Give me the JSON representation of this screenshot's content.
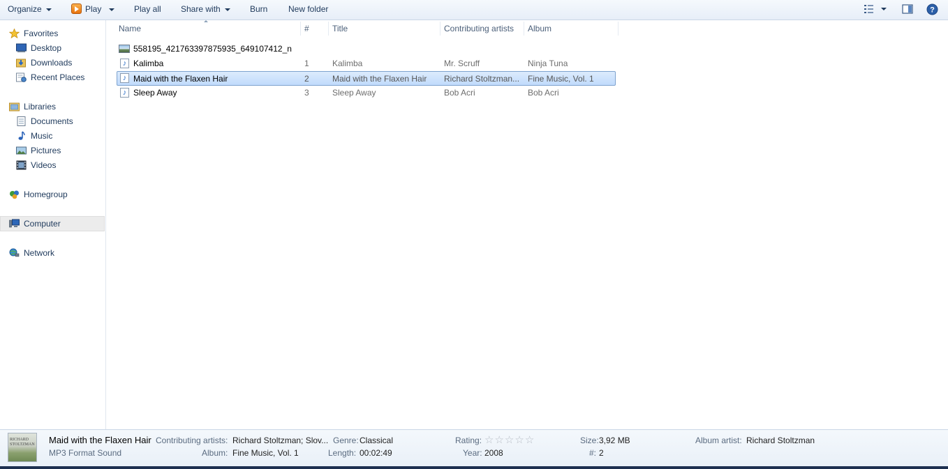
{
  "toolbar": {
    "organize": "Organize",
    "play": "Play",
    "play_all": "Play all",
    "share_with": "Share with",
    "burn": "Burn",
    "new_folder": "New folder"
  },
  "nav": {
    "favorites": "Favorites",
    "desktop": "Desktop",
    "downloads": "Downloads",
    "recent_places": "Recent Places",
    "libraries": "Libraries",
    "documents": "Documents",
    "music": "Music",
    "pictures": "Pictures",
    "videos": "Videos",
    "homegroup": "Homegroup",
    "computer": "Computer",
    "network": "Network"
  },
  "columns": {
    "name": "Name",
    "number": "#",
    "title": "Title",
    "artists": "Contributing artists",
    "album": "Album"
  },
  "files": [
    {
      "name": "558195_421763397875935_649107412_n",
      "number": "",
      "title": "",
      "artists": "",
      "album": "",
      "type": "image"
    },
    {
      "name": "Kalimba",
      "number": "1",
      "title": "Kalimba",
      "artists": "Mr. Scruff",
      "album": "Ninja Tuna",
      "type": "audio"
    },
    {
      "name": "Maid with the Flaxen Hair",
      "number": "2",
      "title": "Maid with the Flaxen Hair",
      "artists": "Richard Stoltzman...",
      "album": "Fine Music, Vol. 1",
      "type": "audio",
      "selected": true
    },
    {
      "name": "Sleep Away",
      "number": "3",
      "title": "Sleep Away",
      "artists": "Bob Acri",
      "album": "Bob Acri",
      "type": "audio"
    }
  ],
  "details": {
    "thumb_text": "RICHARD STOLTZMAN",
    "title": "Maid with the Flaxen Hair",
    "type": "MP3 Format Sound",
    "artists_label": "Contributing artists:",
    "artists_value": "Richard Stoltzman; Slov...",
    "album_label": "Album:",
    "album_value": "Fine Music, Vol. 1",
    "genre_label": "Genre:",
    "genre_value": "Classical",
    "length_label": "Length:",
    "length_value": "00:02:49",
    "rating_label": "Rating:",
    "rating_stars": 0,
    "year_label": "Year:",
    "year_value": "2008",
    "size_label": "Size:",
    "size_value": "3,92 MB",
    "num_label": "#:",
    "num_value": "2",
    "album_artist_label": "Album artist:",
    "album_artist_value": "Richard Stoltzman"
  }
}
